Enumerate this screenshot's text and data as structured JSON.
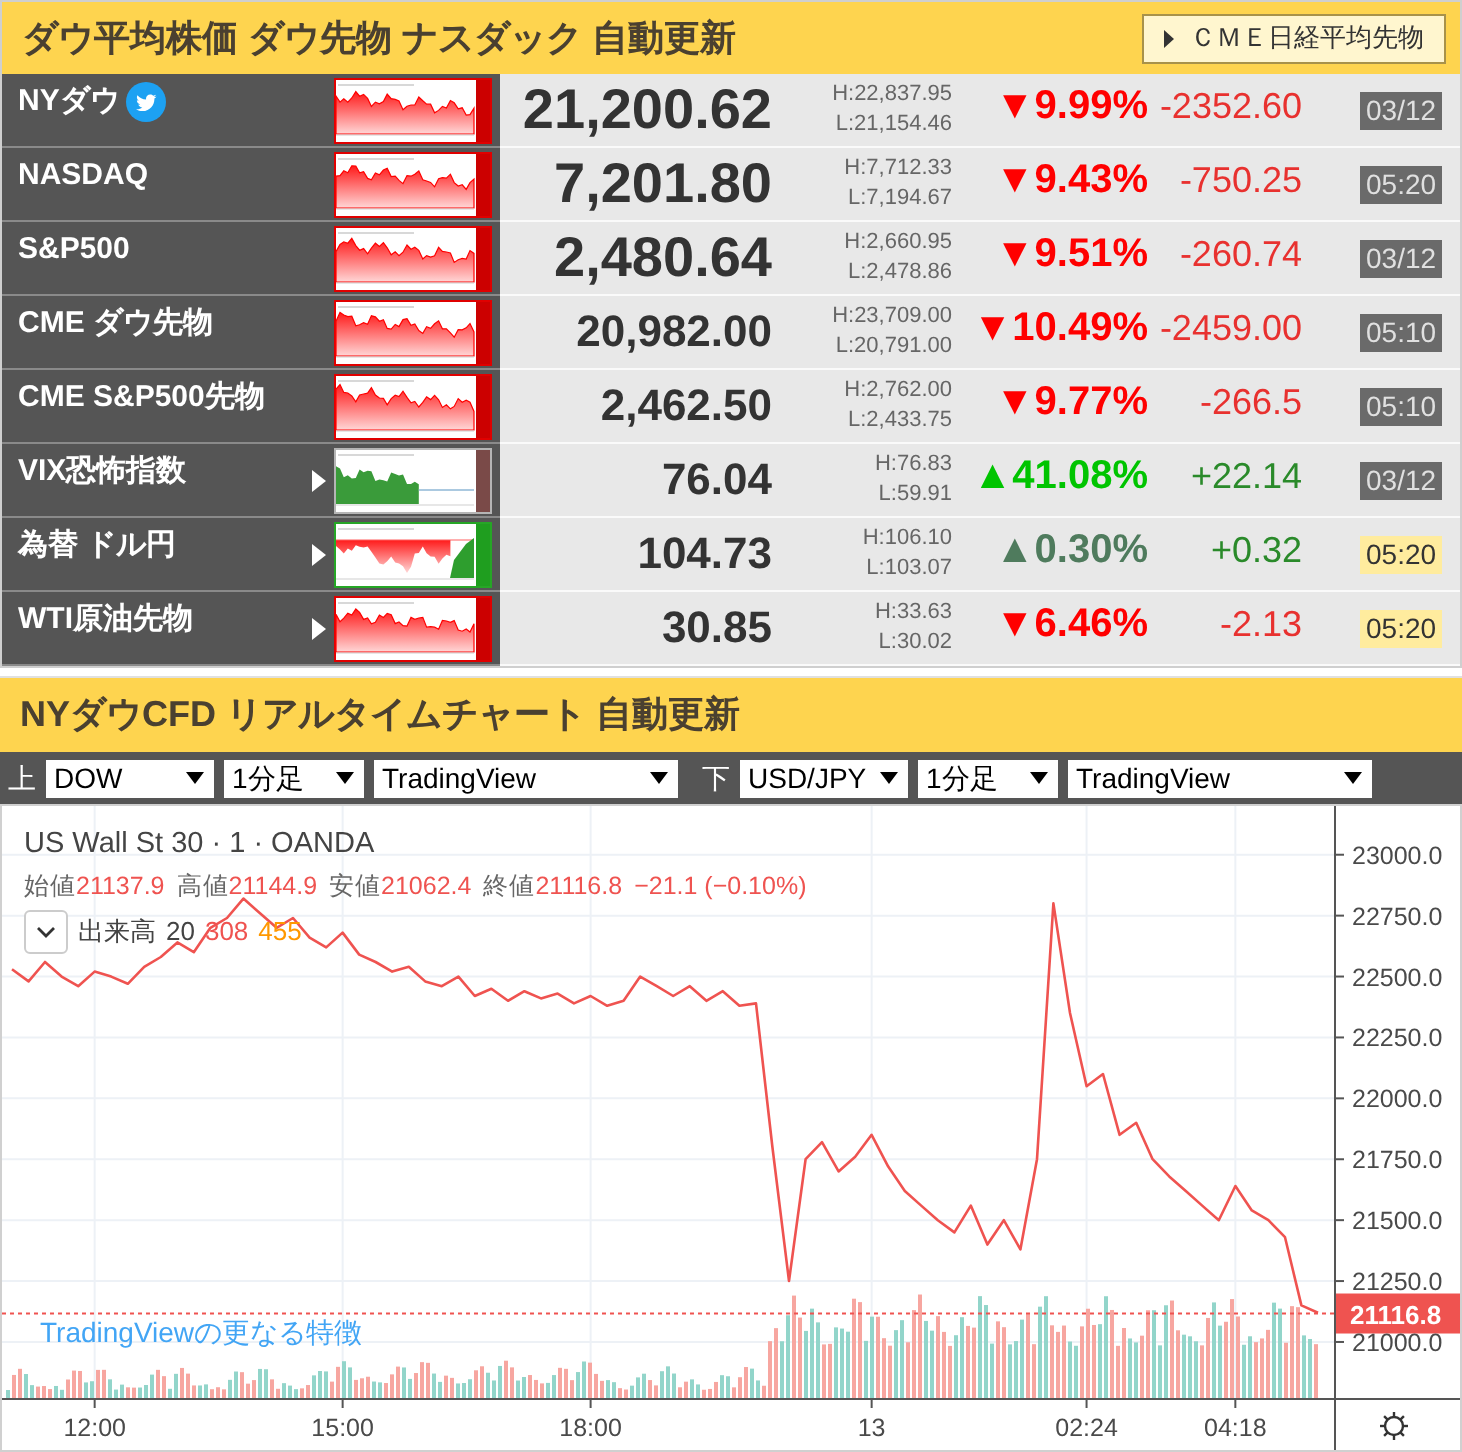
{
  "ticker_panel": {
    "title": "ダウ平均株価 ダウ先物 ナスダック 自動更新",
    "link_button": "ＣＭＥ日経平均先物",
    "rows": [
      {
        "name": "NYダウ",
        "social_icon": true,
        "submenu": false,
        "sparkline": {
          "kind": "down"
        },
        "value": {
          "text": "21,200.62",
          "kind": "large"
        },
        "high": "H:22,837.95",
        "low": "L:21,154.46",
        "pct": {
          "text": "▼9.99%",
          "color": "#ff0000"
        },
        "change": {
          "text": "-2352.60",
          "color": "#e8312f"
        },
        "time": {
          "text": "03/12",
          "highlighted": false
        }
      },
      {
        "name": "NASDAQ",
        "social_icon": false,
        "submenu": false,
        "sparkline": {
          "kind": "down"
        },
        "value": {
          "text": "7,201.80",
          "kind": "large"
        },
        "high": "H:7,712.33",
        "low": "L:7,194.67",
        "pct": {
          "text": "▼9.43%",
          "color": "#ff0000"
        },
        "change": {
          "text": "-750.25",
          "color": "#e8312f"
        },
        "time": {
          "text": "05:20",
          "highlighted": false
        }
      },
      {
        "name": "S&P500",
        "social_icon": false,
        "submenu": false,
        "sparkline": {
          "kind": "down"
        },
        "value": {
          "text": "2,480.64",
          "kind": "large"
        },
        "high": "H:2,660.95",
        "low": "L:2,478.86",
        "pct": {
          "text": "▼9.51%",
          "color": "#ff0000"
        },
        "change": {
          "text": "-260.74",
          "color": "#e8312f"
        },
        "time": {
          "text": "03/12",
          "highlighted": false
        }
      },
      {
        "name": "CME ダウ先物",
        "social_icon": false,
        "submenu": false,
        "sparkline": {
          "kind": "down"
        },
        "value": {
          "text": "20,982.00",
          "kind": "small"
        },
        "high": "H:23,709.00",
        "low": "L:20,791.00",
        "pct": {
          "text": "▼10.49%",
          "color": "#ff0000"
        },
        "change": {
          "text": "-2459.00",
          "color": "#e8312f"
        },
        "time": {
          "text": "05:10",
          "highlighted": false
        }
      },
      {
        "name": "CME S&P500先物",
        "social_icon": false,
        "submenu": false,
        "sparkline": {
          "kind": "down"
        },
        "value": {
          "text": "2,462.50",
          "kind": "small"
        },
        "high": "H:2,762.00",
        "low": "L:2,433.75",
        "pct": {
          "text": "▼9.77%",
          "color": "#ff0000"
        },
        "change": {
          "text": "-266.5",
          "color": "#e8312f"
        },
        "time": {
          "text": "05:10",
          "highlighted": false
        }
      },
      {
        "name": "VIX恐怖指数",
        "social_icon": false,
        "submenu": true,
        "sparkline": {
          "kind": "up"
        },
        "value": {
          "text": "76.04",
          "kind": "small"
        },
        "high": "H:76.83",
        "low": "L:59.91",
        "pct": {
          "text": "▲41.08%",
          "color": "#00c400"
        },
        "change": {
          "text": "+22.14",
          "color": "#2a8a2a"
        },
        "time": {
          "text": "03/12",
          "highlighted": false
        }
      },
      {
        "name": "為替 ドル円",
        "social_icon": false,
        "submenu": true,
        "sparkline": {
          "kind": "mixed"
        },
        "value": {
          "text": "104.73",
          "kind": "small"
        },
        "high": "H:106.10",
        "low": "L:103.07",
        "pct": {
          "text": "▲0.30%",
          "color": "#4f7b5d"
        },
        "change": {
          "text": "+0.32",
          "color": "#2a8a2a"
        },
        "time": {
          "text": "05:20",
          "highlighted": true
        }
      },
      {
        "name": "WTI原油先物",
        "social_icon": false,
        "submenu": true,
        "sparkline": {
          "kind": "down"
        },
        "value": {
          "text": "30.85",
          "kind": "small"
        },
        "high": "H:33.63",
        "low": "L:30.02",
        "pct": {
          "text": "▼6.46%",
          "color": "#ff0000"
        },
        "change": {
          "text": "-2.13",
          "color": "#e8312f"
        },
        "time": {
          "text": "05:20",
          "highlighted": true
        }
      }
    ]
  },
  "chart_panel": {
    "title": "NYダウCFD リアルタイムチャート 自動更新",
    "toolbar": [
      {
        "label": "上",
        "selects": [
          {
            "value": "DOW"
          },
          {
            "value": "1分足"
          },
          {
            "value": "TradingView"
          }
        ]
      },
      {
        "label": "下",
        "selects": [
          {
            "value": "USD/JPY"
          },
          {
            "value": "1分足"
          },
          {
            "value": "TradingView"
          }
        ]
      }
    ],
    "legend": {
      "symbol": "US Wall St 30 · 1 · OANDA",
      "ohlc": [
        {
          "label": "始値",
          "value": "21137.9"
        },
        {
          "label": "高値",
          "value": "21144.9"
        },
        {
          "label": "安値",
          "value": "21062.4"
        },
        {
          "label": "終値",
          "value": "21116.8"
        }
      ],
      "change": "−21.1 (−0.10%)",
      "volume": {
        "label": "出来高",
        "period": "20",
        "values": [
          {
            "text": "308",
            "color": "#ef5350"
          },
          {
            "text": "455",
            "color": "#ff9800"
          }
        ]
      }
    },
    "promo_link": "TradingViewの更なる特徴",
    "chart_data": {
      "type": "line",
      "grid": true,
      "categories": [
        null,
        null,
        null,
        null,
        null,
        "12:00",
        null,
        null,
        null,
        null,
        null,
        null,
        null,
        null,
        null,
        null,
        null,
        null,
        null,
        null,
        "15:00",
        null,
        null,
        null,
        null,
        null,
        null,
        null,
        null,
        null,
        null,
        null,
        null,
        null,
        null,
        "18:00",
        null,
        null,
        null,
        null,
        null,
        null,
        null,
        null,
        null,
        null,
        null,
        null,
        null,
        null,
        null,
        null,
        "13",
        null,
        null,
        null,
        null,
        null,
        null,
        null,
        null,
        null,
        null,
        null,
        null,
        "02:24",
        null,
        null,
        null,
        null,
        null,
        null,
        null,
        null,
        "04:18",
        null,
        null,
        null,
        null,
        null
      ],
      "series": [
        {
          "color": "#ef5350",
          "values": [
            22530,
            22480,
            22560,
            22500,
            22460,
            22520,
            22500,
            22470,
            22540,
            22580,
            22640,
            22600,
            22700,
            22740,
            22820,
            22760,
            22700,
            22740,
            22660,
            22620,
            22680,
            22590,
            22560,
            22520,
            22540,
            22480,
            22460,
            22500,
            22420,
            22450,
            22400,
            22440,
            22410,
            22430,
            22390,
            22420,
            22380,
            22400,
            22500,
            22460,
            22420,
            22460,
            22400,
            22440,
            22380,
            22390,
            21800,
            21250,
            21750,
            21820,
            21700,
            21760,
            21850,
            21720,
            21620,
            21560,
            21500,
            21450,
            21560,
            21400,
            21500,
            21380,
            21750,
            22800,
            22350,
            22050,
            22100,
            21850,
            21900,
            21750,
            21680,
            21620,
            21560,
            21500,
            21640,
            21540,
            21500,
            21430,
            21150,
            21120
          ]
        }
      ],
      "ref_lines": [
        {
          "axis": "y",
          "value": 21116.8,
          "label": "21116.8",
          "color": "#ef5350"
        }
      ],
      "ylim": [
        20770,
        23200
      ],
      "yticks": [
        {
          "value": 21000,
          "label": "21000.0"
        },
        {
          "value": 21250,
          "label": "21250.0"
        },
        {
          "value": 21500,
          "label": "21500.0"
        },
        {
          "value": 21750,
          "label": "21750.0"
        },
        {
          "value": 22000,
          "label": "22000.0"
        },
        {
          "value": 22250,
          "label": "22250.0"
        },
        {
          "value": 22500,
          "label": "22500.0"
        },
        {
          "value": 22750,
          "label": "22750.0"
        },
        {
          "value": 23000,
          "label": "23000.0"
        }
      ]
    }
  }
}
